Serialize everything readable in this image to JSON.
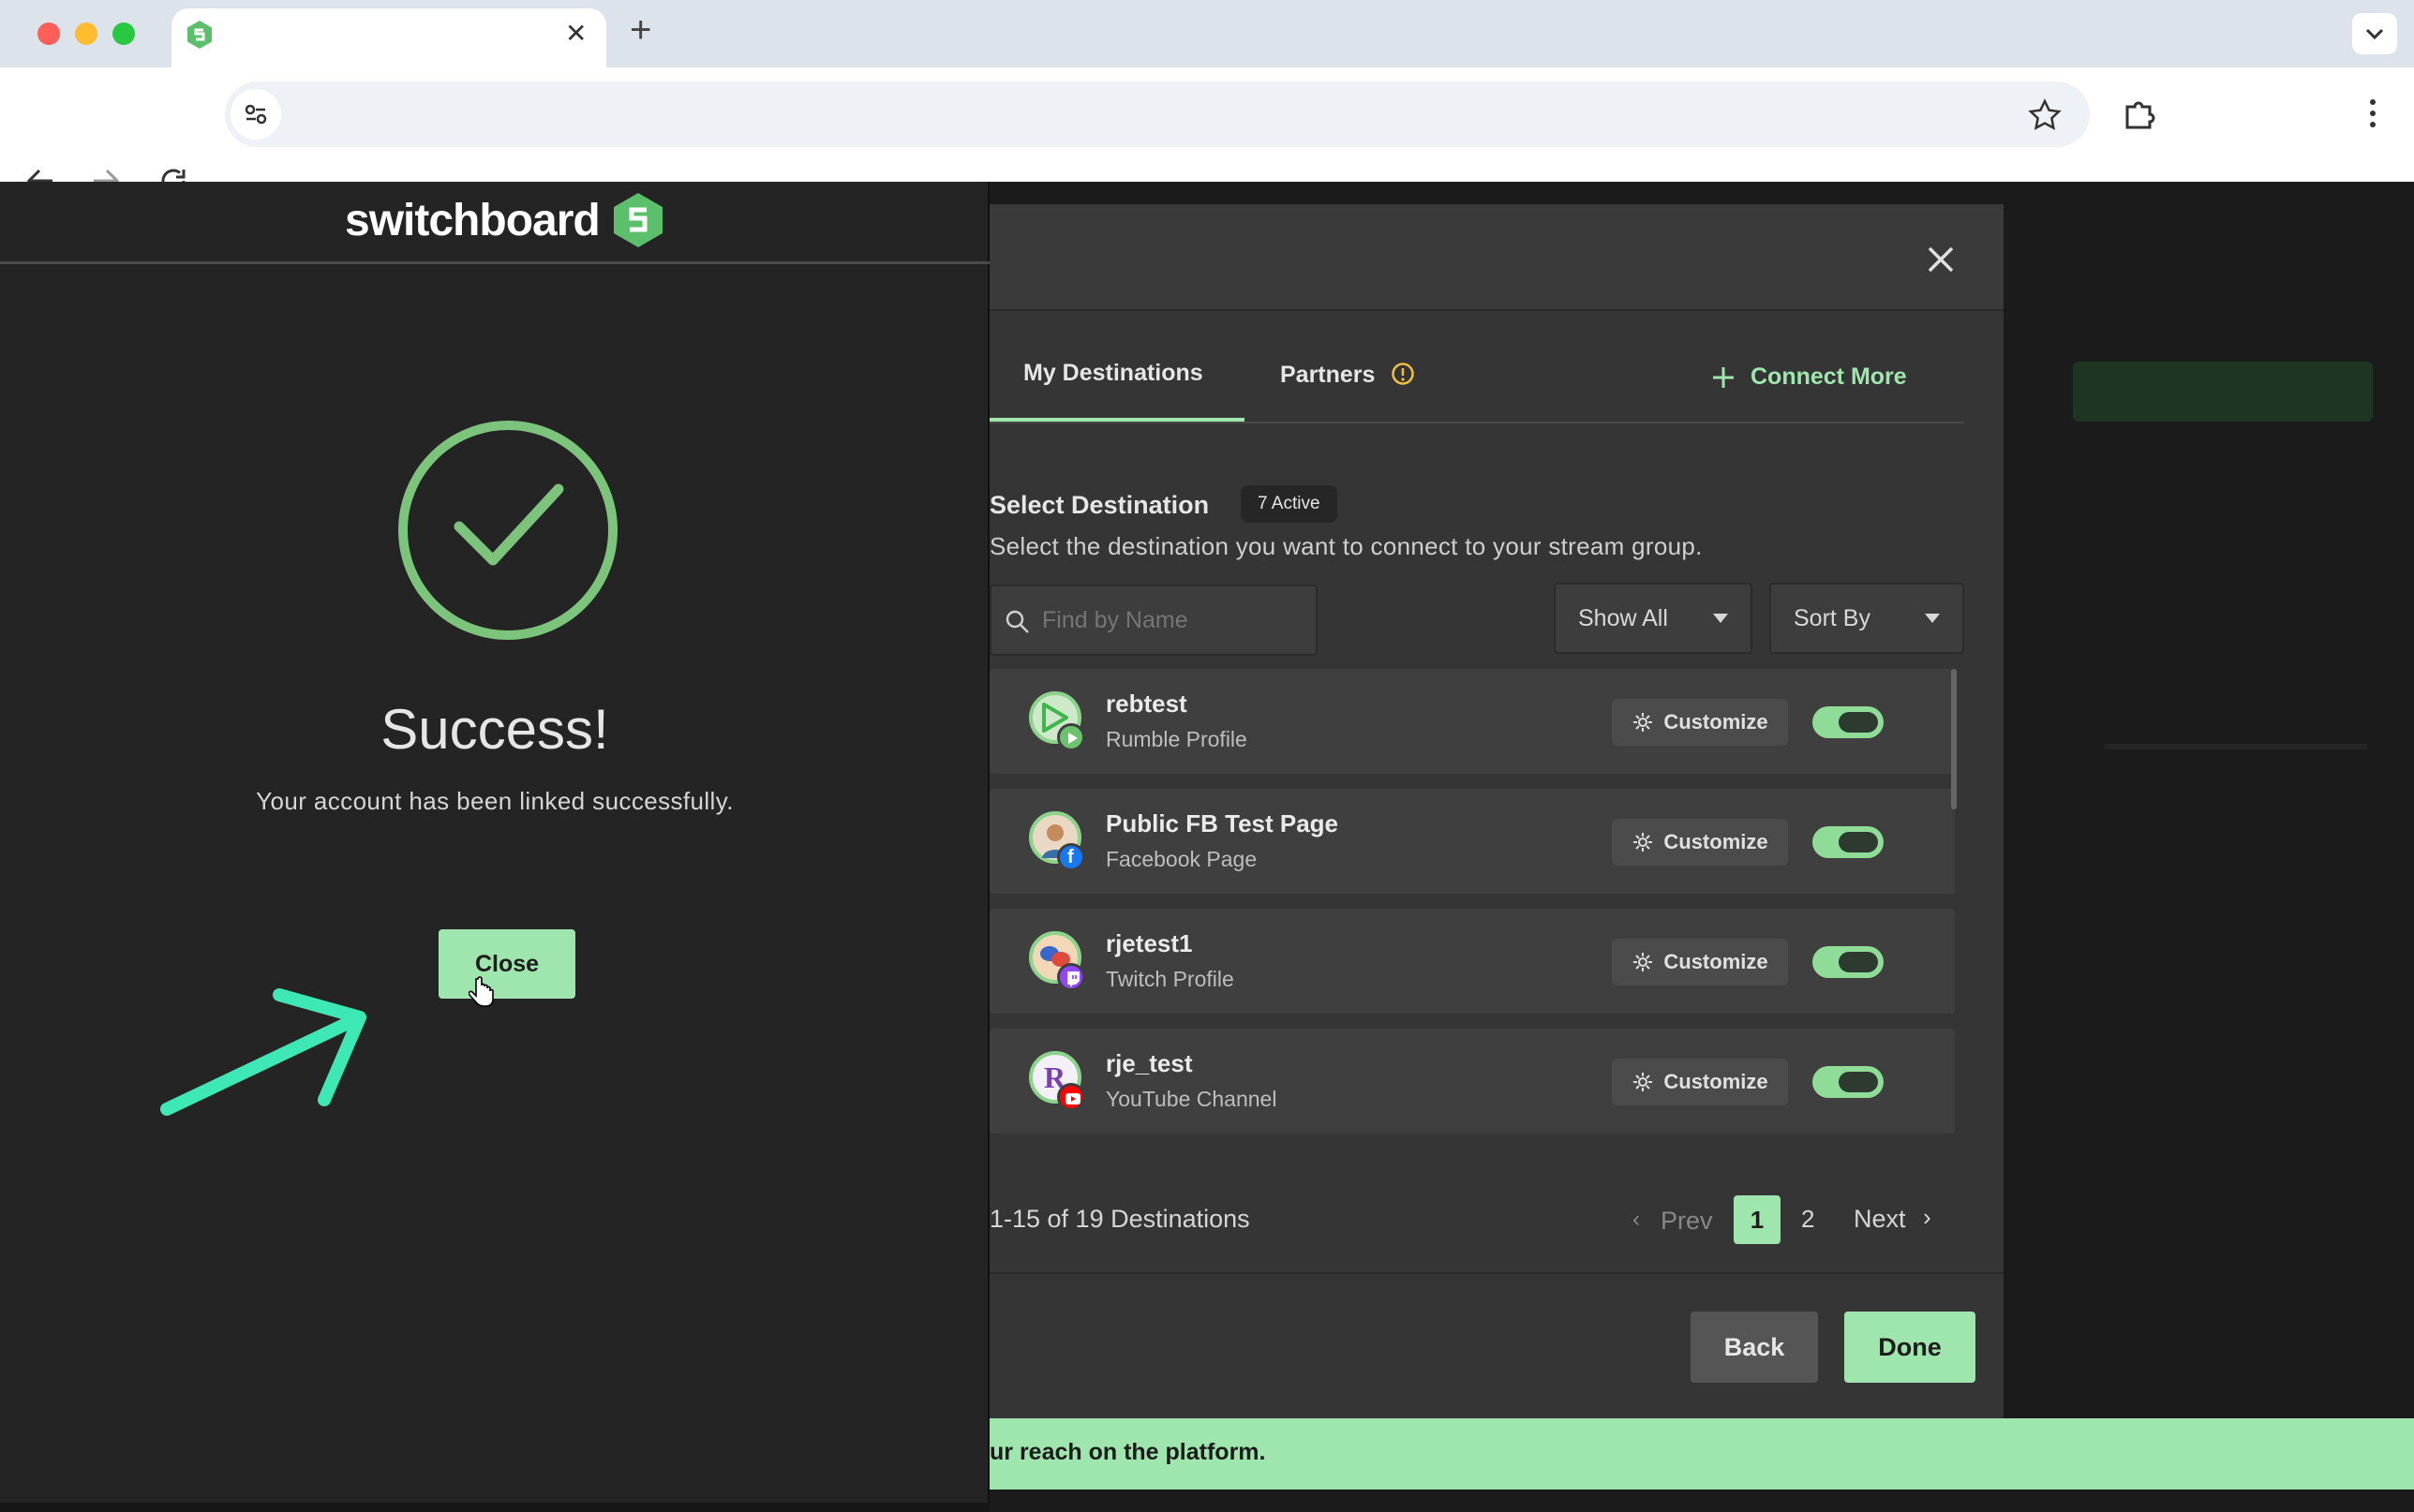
{
  "browser": {
    "tab_close": "✕",
    "new_tab": "+",
    "url": ""
  },
  "popup": {
    "brand": "switchboard",
    "title": "Success!",
    "message": "Your account has been linked successfully.",
    "close_label": "Close"
  },
  "modal": {
    "tabs": [
      {
        "label": "My Destinations"
      },
      {
        "label": "Partners"
      }
    ],
    "connect_more": "Connect More",
    "select_title": "Select Destination",
    "active_badge": "7 Active",
    "subtitle": "Select the destination you want to connect to your stream group.",
    "search_placeholder": "Find by Name",
    "filter_label": "Show All",
    "sort_label": "Sort By",
    "customize_label": "Customize",
    "destinations": [
      {
        "name": "rebtest",
        "type": "Rumble Profile",
        "platform": "rumble",
        "enabled": true
      },
      {
        "name": "Public FB Test Page",
        "type": "Facebook Page",
        "platform": "facebook",
        "enabled": true
      },
      {
        "name": "rjetest1",
        "type": "Twitch Profile",
        "platform": "twitch",
        "enabled": true
      },
      {
        "name": "rje_test",
        "type": "YouTube Channel",
        "platform": "youtube",
        "enabled": true
      }
    ],
    "pagination": {
      "summary": "1-15 of 19 Destinations",
      "prev": "Prev",
      "pages": [
        "1",
        "2"
      ],
      "current": "1",
      "next": "Next"
    },
    "back_label": "Back",
    "done_label": "Done"
  },
  "banner_text": "ur reach on the platform.",
  "colors": {
    "accent": "#9ee6ad",
    "success_ring": "#7cc47c",
    "annotation_arrow": "#3ee8b4"
  }
}
